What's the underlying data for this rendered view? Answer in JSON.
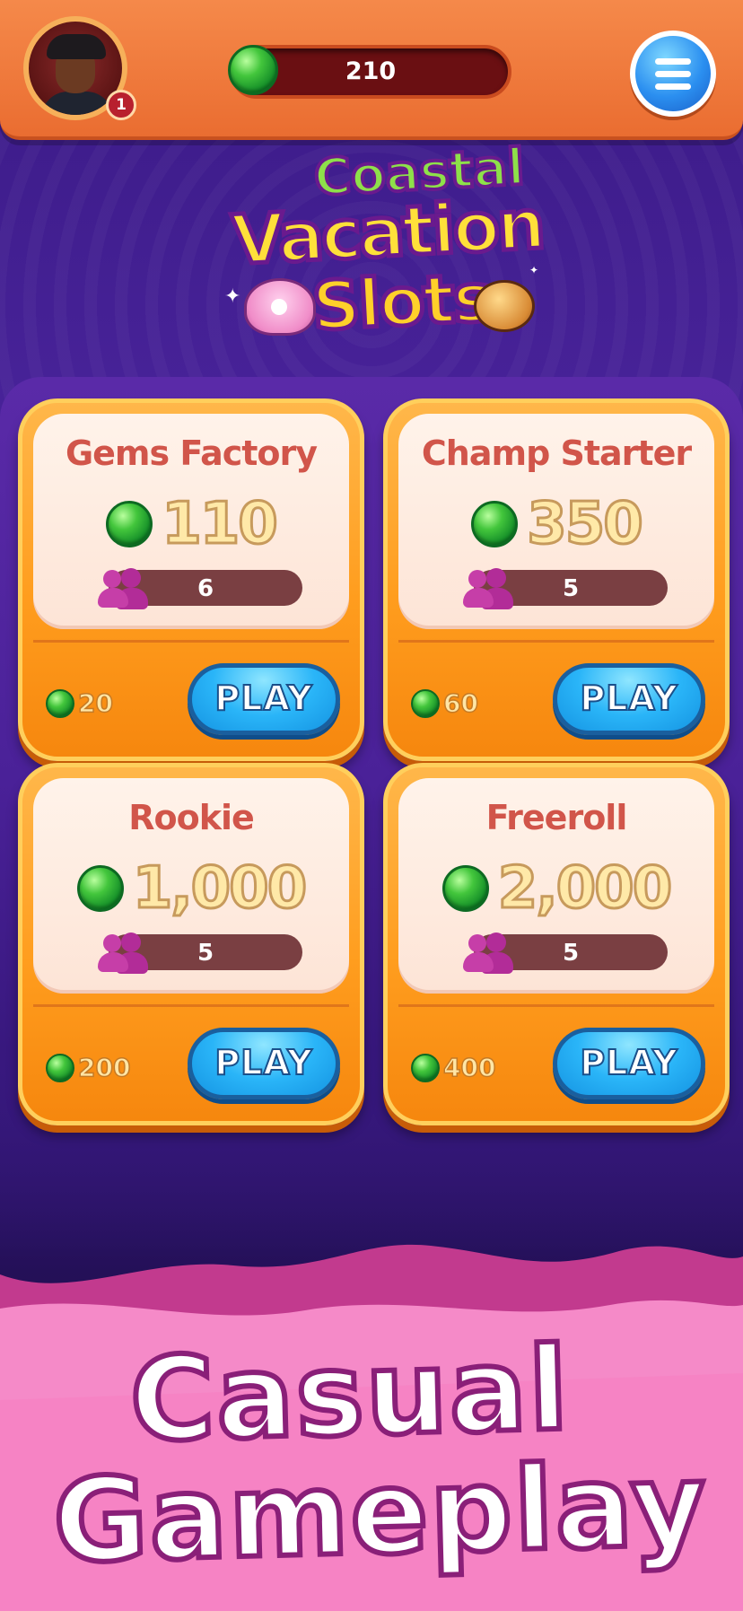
{
  "header": {
    "level_badge": "1",
    "gem_balance": "210"
  },
  "logo": {
    "line1": "Coastal",
    "line2": "Vacation",
    "line3": "Slots"
  },
  "rooms": [
    {
      "title": "Gems Factory",
      "prize": "110",
      "players": "6",
      "entry": "20",
      "play_label": "PLAY"
    },
    {
      "title": "Champ Starter",
      "prize": "350",
      "players": "5",
      "entry": "60",
      "play_label": "PLAY"
    },
    {
      "title": "Rookie",
      "prize": "1,000",
      "players": "5",
      "entry": "200",
      "play_label": "PLAY"
    },
    {
      "title": "Freeroll",
      "prize": "2,000",
      "players": "5",
      "entry": "400",
      "play_label": "PLAY"
    }
  ],
  "banner": {
    "line1": "Casual",
    "line2": "Gameplay"
  },
  "colors": {
    "header_orange": "#ea6d31",
    "card_orange": "#ff9d1e",
    "title_red": "#d1554a",
    "play_blue": "#2ab5f8",
    "gem_green": "#43c63c",
    "banner_pink": "#f06ab4"
  }
}
